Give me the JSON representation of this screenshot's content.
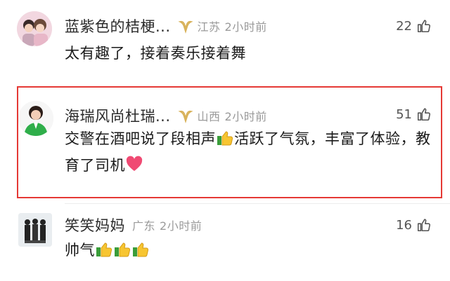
{
  "comments": [
    {
      "name": "蓝紫色的桔梗...",
      "location": "江苏",
      "time": "2小时前",
      "likes": "22",
      "text": "太有趣了，接着奏乐接着舞"
    },
    {
      "name": "海瑞风尚杜瑞...",
      "location": "山西",
      "time": "2小时前",
      "likes": "51",
      "text_part1": "交警在酒吧说了段相声",
      "text_part2": "活跃了气氛，丰富了体验，教育了司机",
      "highlighted": true
    },
    {
      "name": "笑笑妈妈",
      "location": "广东",
      "time": "2小时前",
      "likes": "16",
      "text": "帅气"
    }
  ],
  "colors": {
    "highlight_border": "#e53935",
    "badge_gold": "#d8b25a",
    "meta_gray": "#9a9a9a"
  },
  "icons": {
    "badge": "verified-v-badge-icon",
    "like": "thumbs-up-outline-icon",
    "emoji_like": "thumbs-up-emoji-icon",
    "emoji_heart": "heart-emoji-icon"
  }
}
